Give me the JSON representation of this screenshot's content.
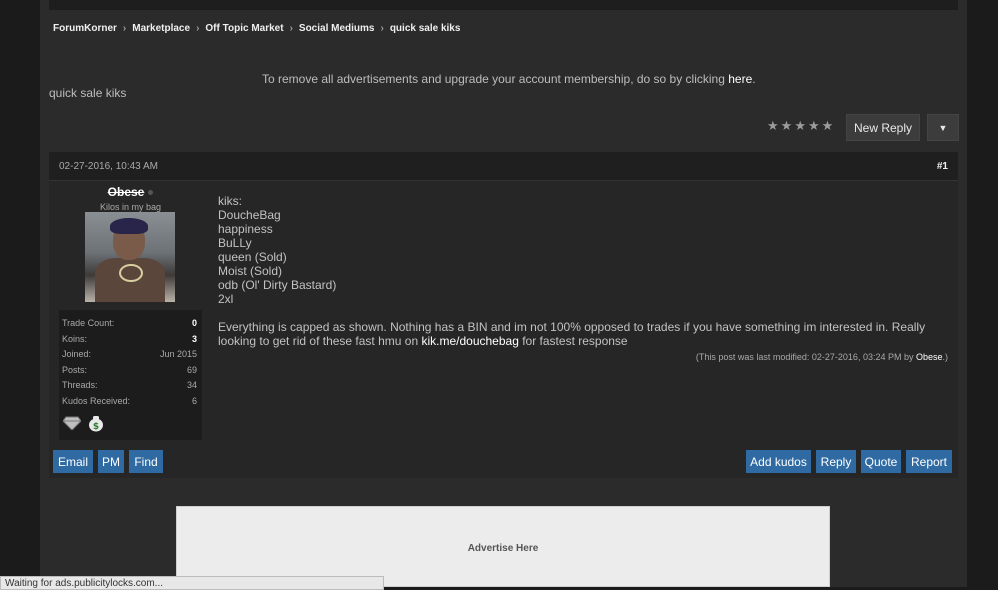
{
  "breadcrumb": [
    "ForumKorner",
    "Marketplace",
    "Off Topic Market",
    "Social Mediums",
    "quick sale kiks"
  ],
  "ad_notice": {
    "text": "To remove all advertisements and upgrade your account membership, do so by clicking ",
    "link": "here",
    "suffix": "."
  },
  "thread": {
    "title": "quick sale kiks",
    "rating_icon": "star-icon",
    "new_reply_label": "New Reply",
    "dropdown_icon": "caret-down-icon"
  },
  "post": {
    "date": "02-27-2016, 10:43 AM",
    "number": "#1",
    "user": {
      "name": "Obese",
      "title": "Kilos in my bag",
      "stats": [
        {
          "label": "Trade Count:",
          "value": "0",
          "strong": true
        },
        {
          "label": "Koins:",
          "value": "3",
          "strong": true
        },
        {
          "label": "Joined:",
          "value": "Jun 2015",
          "strong": false
        },
        {
          "label": "Posts:",
          "value": "69",
          "strong": false
        },
        {
          "label": "Threads:",
          "value": "34",
          "strong": false
        },
        {
          "label": "Kudos Received:",
          "value": "6",
          "strong": false
        }
      ],
      "badges": [
        "diamond-icon",
        "money-bag-icon"
      ]
    },
    "lines": [
      "kiks:",
      "DoucheBag",
      "happiness",
      "BuLLy",
      "queen (Sold)",
      "Moist (Sold)",
      "odb (Ol' Dirty Bastard)",
      "2xl"
    ],
    "paragraph": {
      "text": "Everything is capped as shown. Nothing has a BIN and im not 100% opposed to trades if you have something im interested in. Really looking to get rid of these fast hmu on ",
      "link": "kik.me/douchebag",
      "suffix": " for fastest response"
    },
    "modified": {
      "prefix": "(This post was last modified: 02-27-2016, 03:24 PM by ",
      "by": "Obese",
      "suffix": ".)"
    },
    "left_buttons": [
      "Email",
      "PM",
      "Find"
    ],
    "right_buttons": [
      "Add kudos",
      "Reply",
      "Quote",
      "Report"
    ]
  },
  "advert": {
    "label": "Advertise Here"
  },
  "status_bar": {
    "text": "Waiting for ads.publicitylocks.com..."
  },
  "colors": {
    "button_blue": "#2f6aa3",
    "background": "#2b2b2b"
  }
}
